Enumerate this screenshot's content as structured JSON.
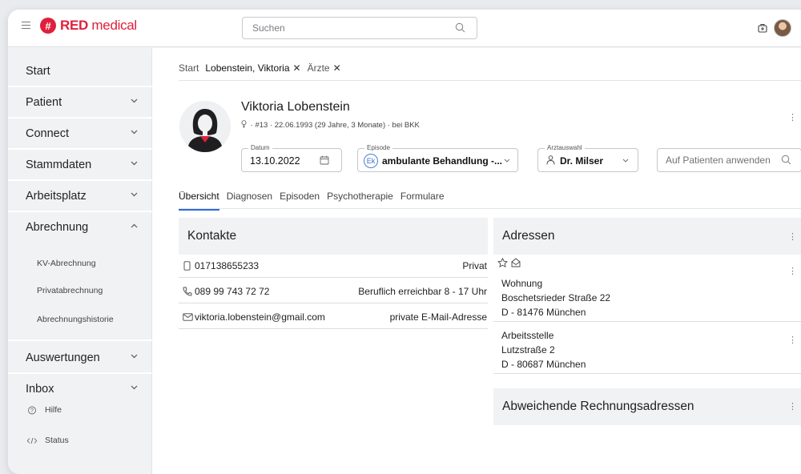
{
  "header": {
    "brand_bold": "RED",
    "brand_light": " medical",
    "search_placeholder": "Suchen"
  },
  "sidebar": {
    "items": [
      {
        "label": "Start"
      },
      {
        "label": "Patient"
      },
      {
        "label": "Connect"
      },
      {
        "label": "Stammdaten"
      },
      {
        "label": "Arbeitsplatz"
      },
      {
        "label": "Abrechnung"
      },
      {
        "label": "Auswertungen"
      },
      {
        "label": "Inbox"
      }
    ],
    "subitems": [
      "KV-Abrechnung",
      "Privatabrechnung",
      "Abrechnungshistorie"
    ],
    "help": "Hilfe",
    "status": "Status"
  },
  "breadcrumb": [
    {
      "label": "Start"
    },
    {
      "label": "Lobenstein, Viktoria"
    },
    {
      "label": "Ärzte"
    }
  ],
  "patient": {
    "name": "Viktoria Lobenstein",
    "meta": "· #13 · 22.06.1993 (29 Jahre, 3 Monate) · bei BKK"
  },
  "fields": {
    "datum_label": "Datum",
    "datum_value": "13.10.2022",
    "episode_label": "Episode",
    "episode_badge": "Ek",
    "episode_value": "ambulante Behandlung -...",
    "arzt_label": "Arztauswahl",
    "arzt_value": "Dr. Milser",
    "apply_placeholder": "Auf Patienten anwenden"
  },
  "tabs": [
    "Übersicht",
    "Diagnosen",
    "Episoden",
    "Psychotherapie",
    "Formulare"
  ],
  "kontakte": {
    "title": "Kontakte",
    "rows": [
      {
        "value": "017138655233",
        "type": "Privat"
      },
      {
        "value": "089 99 743 72 72",
        "type": "Beruflich erreichbar 8 - 17 Uhr"
      },
      {
        "value": "viktoria.lobenstein@gmail.com",
        "type": "private E-Mail-Adresse"
      }
    ]
  },
  "adressen": {
    "title": "Adressen",
    "items": [
      {
        "kind": "Wohnung",
        "street": "Boschetsrieder Straße 22",
        "city": "D - 81476 München"
      },
      {
        "kind": "Arbeitsstelle",
        "street": "Lutzstraße 2",
        "city": "D - 80687 München"
      }
    ]
  },
  "rechnung": {
    "title": "Abweichende Rechnungsadressen"
  },
  "colors": {
    "brand": "#e0203b",
    "accent": "#2d6ad8"
  }
}
